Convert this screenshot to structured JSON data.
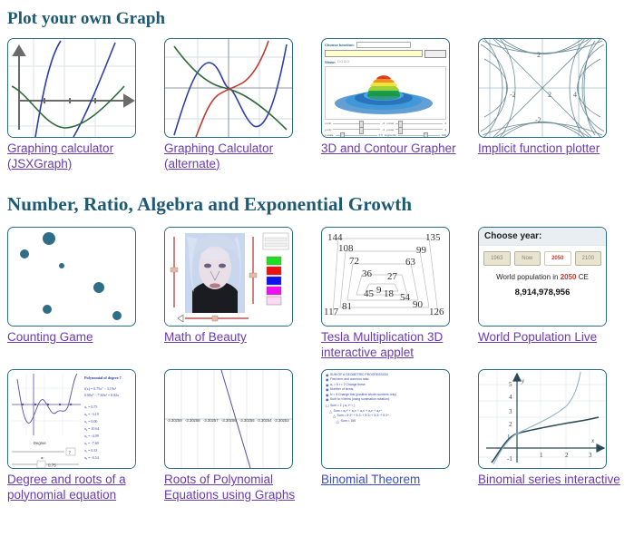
{
  "sections": [
    {
      "id": "plot-your-own-graph",
      "heading": "Plot your own Graph",
      "items": [
        {
          "id": "graphing-calculator-jsxgraph",
          "caption": "Graphing calculator (JSXGraph)",
          "thumb": "graph-axes-curves"
        },
        {
          "id": "graphing-calculator-alternate",
          "caption": "Graphing Calculator (alternate)",
          "thumb": "graph-three-curves"
        },
        {
          "id": "3d-and-contour-grapher",
          "caption": "3D and Contour Grapher",
          "thumb": "grapher-ui"
        },
        {
          "id": "implicit-function-plotter",
          "caption": "Implicit function plotter",
          "thumb": "contour-hyperbola"
        }
      ]
    },
    {
      "id": "number-ratio-algebra-exponential-growth",
      "heading": "Number, Ratio, Algebra and Exponential Growth",
      "items": [
        {
          "id": "counting-game",
          "caption": "Counting Game",
          "thumb": "dots"
        },
        {
          "id": "math-of-beauty",
          "caption": "Math of Beauty",
          "thumb": "beauty-photo"
        },
        {
          "id": "tesla-multiplication",
          "caption": "Tesla Multiplication 3D interactive applet",
          "thumb": "tesla-numbers"
        },
        {
          "id": "world-population-live",
          "caption": "World Population Live",
          "thumb": "population-widget"
        },
        {
          "id": "degree-and-roots",
          "caption": "Degree and roots of a polynomial equation",
          "thumb": "polynomial-applet"
        },
        {
          "id": "roots-of-polynomial-equations",
          "caption": "Roots of Polynomial Equations using Graphs",
          "thumb": "zoomed-root"
        },
        {
          "id": "binomial-theorem",
          "caption": "Binomial Theorem",
          "thumb": "geometric-progression"
        },
        {
          "id": "binomial-series-interactive",
          "caption": "Binomial series interactive",
          "thumb": "binomial-curve"
        }
      ]
    }
  ],
  "grapher3d": {
    "choose_function_label": "Choose function:",
    "function_value": "exp(-(x^2+y^2))",
    "graph_button": "Graph it",
    "show_label": "Show:",
    "show_options": [
      "floor",
      "axes",
      "mesh",
      "contour"
    ],
    "slider_rows": [
      {
        "left_label": "x-min",
        "left_value": "-4",
        "right_label": "x-max",
        "right_value": "4"
      },
      {
        "left_label": "y-min",
        "left_value": "-4",
        "right_label": "y-max",
        "right_value": "4"
      },
      {
        "left_label": "z-scale",
        "left_value": "0.5",
        "right_label": "segments",
        "right_value": "100"
      }
    ]
  },
  "implicit_plot": {
    "tick_labels": [
      "-2",
      "2",
      "4",
      "2",
      "-2"
    ]
  },
  "tesla": {
    "numbers": [
      "144",
      "135",
      "108",
      "99",
      "72",
      "63",
      "36",
      "27",
      "45",
      "9",
      "18",
      "54",
      "117",
      "81",
      "90",
      "126"
    ]
  },
  "world_population": {
    "title": "Choose year:",
    "year_buttons": [
      "1963",
      "Now",
      "2050",
      "2100"
    ],
    "selected_year": "2050",
    "caption_prefix": "World population in ",
    "caption_year": "2050",
    "caption_suffix": " CE",
    "population": "8,914,978,956",
    "accent_color": "#c0392b"
  },
  "polynomial_applet": {
    "title": "Polynomial of degree 7",
    "equation_line1": "f(x) = 0.75x⁷ − 3.19x⁶",
    "equation_line2": "0.00x⁵ − 7.60x³ + 0.02x",
    "coefficients": [
      "a₇ = 0.75",
      "a₆ = -3.19",
      "a₅ = 0.00",
      "a₄ = 10.64",
      "a₃ = -4.09",
      "a₂ = -7.60",
      "a₁ = 0.33",
      "a₀ = -0.54"
    ],
    "degree_label": "Degree",
    "degree_value": "7",
    "a_label": "a₇",
    "a_value": "0.75"
  },
  "roots_graph": {
    "tick_labels": [
      "-3.30259",
      "-3.30258",
      "-3.30257",
      "-3.30256",
      "-3.30255",
      "-3.30254",
      "-3.30253"
    ]
  },
  "binomial_theorem": {
    "title": "SUM OF A GEOMETRIC PROGRESSION",
    "lines": [
      "First term and common ratio:",
      "a₁ = 5   r = 2   Change these",
      "Number of terms:",
      "N = 5   Change this (positive whole numbers only)",
      "Sum to n terms (using summation notation):",
      "Sum = Σ ( a₁ rⁿ⁻¹ )",
      "Sum = a₁r⁰ + a₁r¹ + a₁r² + a₁r³ + a₁r⁴",
      "Sum = 5·2⁰ + 5·2¹ + 5·2² + 5·2³ + 5·2⁴",
      "Sum = 155"
    ]
  },
  "binomial_curve": {
    "y_ticks": [
      "5",
      "4",
      "3",
      "2",
      "1",
      "-1"
    ],
    "x_ticks": [
      "1",
      "2",
      "3"
    ],
    "x_label": "x",
    "y_label": "y"
  },
  "colors": {
    "heading": "#1d5973",
    "link": "#6a3ab2",
    "thumb_border": "#2b6e86",
    "dot": "#2e6e87"
  }
}
